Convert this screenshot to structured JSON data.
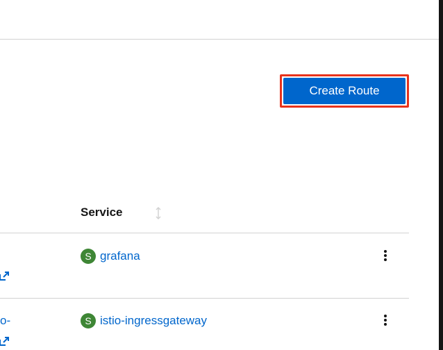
{
  "toolbar": {
    "create_route_label": "Create Route"
  },
  "table": {
    "columns": [
      {
        "label": "Service",
        "sortable": true
      }
    ],
    "rows": [
      {
        "name_fragment": "",
        "service_badge": "S",
        "service_name": "grafana"
      },
      {
        "name_fragment": "o-",
        "service_badge": "S",
        "service_name": "istio-ingressgateway"
      }
    ]
  },
  "colors": {
    "primary": "#0066cc",
    "service_badge": "#3e8635",
    "highlight_border": "#e8321b"
  },
  "icons": {
    "sort": "sort-icon",
    "kebab": "kebab-icon",
    "external_link": "external-link-icon"
  }
}
